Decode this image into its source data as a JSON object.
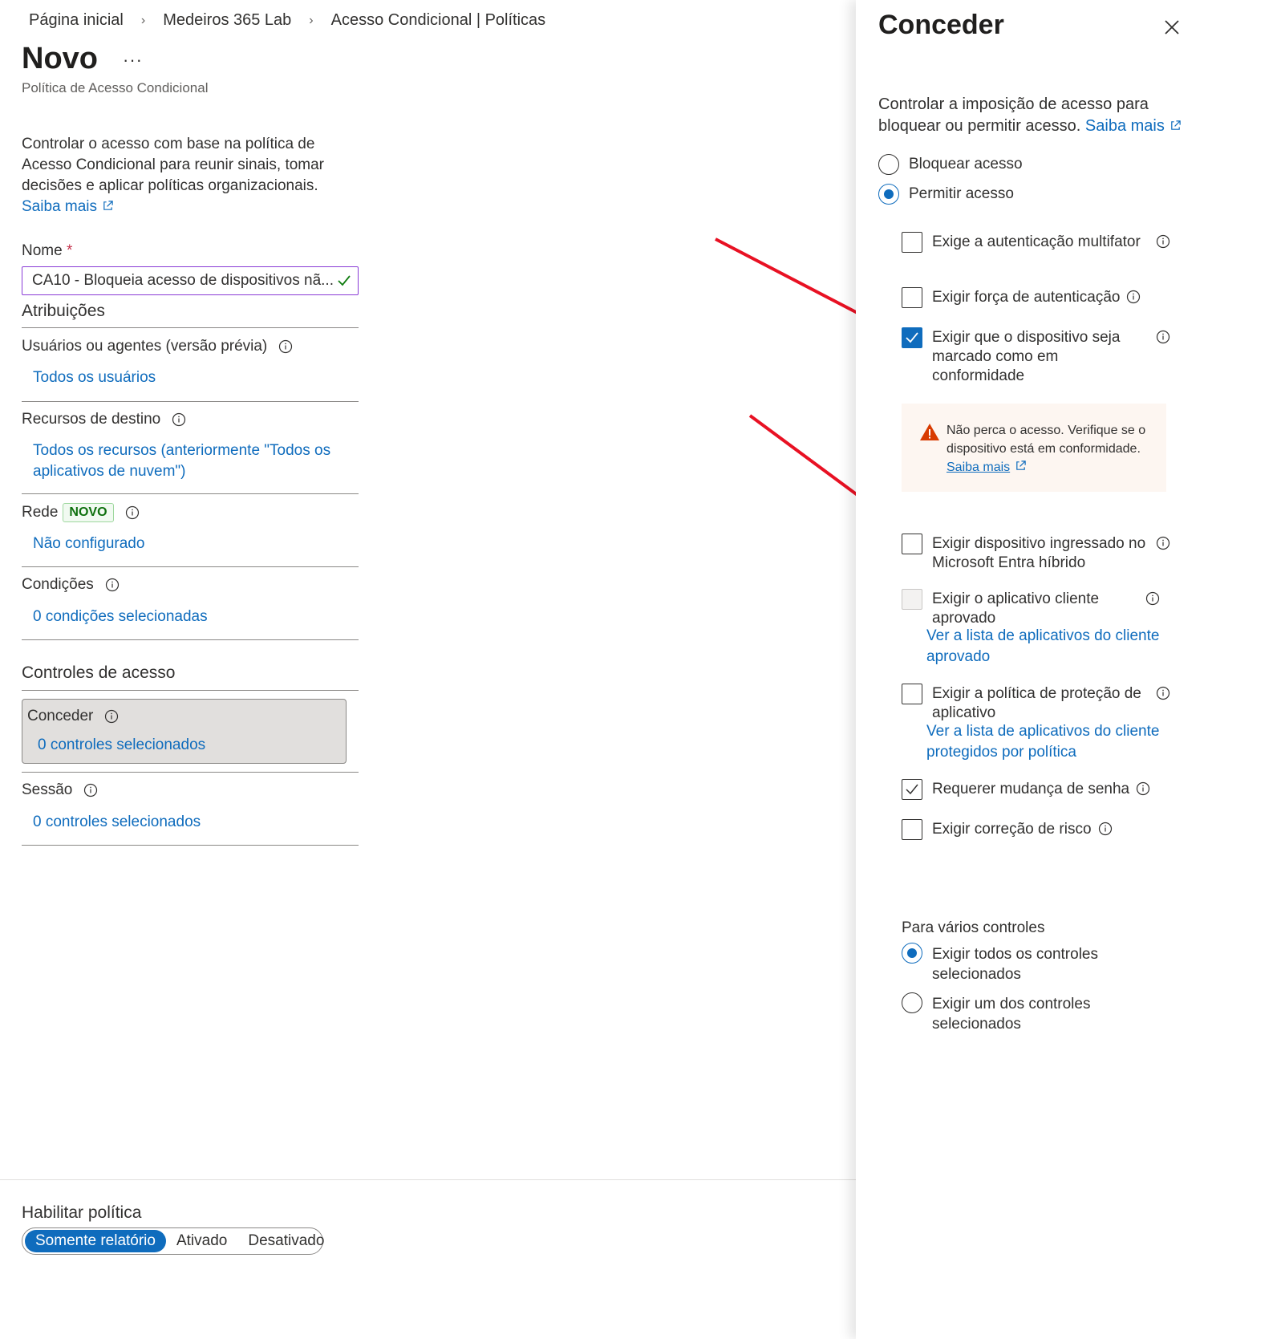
{
  "breadcrumb": [
    "Página inicial",
    "Medeiros 365 Lab",
    "Acesso Condicional | Políticas"
  ],
  "page": {
    "title": "Novo",
    "subtitle": "Política de Acesso Condicional",
    "intro_text": "Controlar o acesso com base na política de Acesso Condicional para reunir sinais, tomar decisões e aplicar políticas organizacionais.",
    "learn_more": "Saiba mais"
  },
  "name_field": {
    "label": "Nome",
    "required_mark": "*",
    "value": "CA10 - Bloqueia acesso de dispositivos nã..."
  },
  "assignments": {
    "heading": "Atribuições",
    "users_title": "Usuários ou agentes (versão prévia)",
    "users_value": "Todos os usuários",
    "resources_title": "Recursos de destino",
    "resources_value": "Todos os recursos (anteriormente \"Todos os aplicativos de nuvem\")",
    "network_title": "Rede",
    "network_badge": "NOVO",
    "network_value": "Não configurado",
    "conditions_title": "Condições",
    "conditions_value": "0 condições selecionadas"
  },
  "access_controls": {
    "heading": "Controles de acesso",
    "grant_title": "Conceder",
    "grant_value": "0 controles selecionados",
    "session_title": "Sessão",
    "session_value": "0 controles selecionados"
  },
  "enable_policy": {
    "label": "Habilitar política",
    "options": [
      "Somente relatório",
      "Ativado",
      "Desativado"
    ],
    "selected": "Somente relatório"
  },
  "panel": {
    "title": "Conceder",
    "description": "Controlar a imposição de acesso para bloquear ou permitir acesso.",
    "learn_more": "Saiba mais",
    "access_options": [
      "Bloquear acesso",
      "Permitir acesso"
    ],
    "access_selected": "Permitir acesso",
    "controls": [
      {
        "label": "Exige a autenticação multifator",
        "checked": false
      },
      {
        "label": "Exigir força de autenticação",
        "checked": false
      },
      {
        "label": "Exigir que o dispositivo seja marcado como em conformidade",
        "checked": true
      },
      {
        "label": "Exigir dispositivo ingressado no Microsoft Entra híbrido",
        "checked": false
      },
      {
        "label": "Exigir o aplicativo cliente aprovado",
        "checked": false,
        "disabled": true,
        "link": "Ver a lista de aplicativos do cliente aprovado"
      },
      {
        "label": "Exigir a política de proteção de aplicativo",
        "checked": false,
        "link": "Ver a lista de aplicativos do cliente protegidos por política"
      },
      {
        "label": "Requerer mudança de senha",
        "checked": true
      },
      {
        "label": "Exigir correção de risco",
        "checked": false
      }
    ],
    "warning": {
      "text": "Não perca o acesso. Verifique se o dispositivo está em conformidade.",
      "link": "Saiba mais"
    },
    "multi_controls_label": "Para vários controles",
    "multi_options": [
      "Exigir todos os controles selecionados",
      "Exigir um dos controles selecionados"
    ],
    "multi_selected": "Exigir todos os controles selecionados"
  },
  "colors": {
    "accent": "#0f6cbd",
    "arrow": "#e81123",
    "warning": "#d83b01",
    "input_border": "#8a3bd6",
    "valid_check": "#107c10"
  }
}
